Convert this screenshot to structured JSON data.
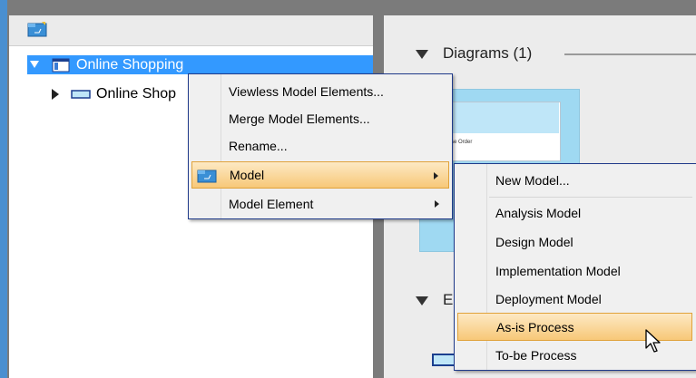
{
  "tree": {
    "items": [
      {
        "label": "Online Shopping",
        "selected": true
      },
      {
        "label": "Online Shop"
      }
    ]
  },
  "diagrams": {
    "title": "Diagrams (1)",
    "thumb_caption": "Purchase Order",
    "second_title_partial": "E"
  },
  "context_menu": {
    "items": [
      {
        "label": "Viewless Model Elements..."
      },
      {
        "label": "Merge Model Elements..."
      },
      {
        "label": "Rename..."
      },
      {
        "label": "Model",
        "highlighted": true,
        "submenu": true
      },
      {
        "label": "Model Element",
        "submenu": true
      }
    ]
  },
  "model_submenu": {
    "items": [
      {
        "label": "New Model..."
      },
      {
        "label": "Analysis Model"
      },
      {
        "label": "Design Model"
      },
      {
        "label": "Implementation Model"
      },
      {
        "label": "Deployment Model"
      },
      {
        "label": "As-is Process",
        "highlighted": true
      },
      {
        "label": "To-be Process"
      }
    ]
  },
  "colors": {
    "selection": "#3399ff",
    "menu_highlight": "#f7c878",
    "menu_border": "#1f3a8a",
    "thumb": "#9fd9f2"
  },
  "icons": [
    "model-icon",
    "diagram-icon",
    "expand-triangle",
    "collapse-triangle",
    "submenu-arrow",
    "mouse-pointer-icon"
  ]
}
